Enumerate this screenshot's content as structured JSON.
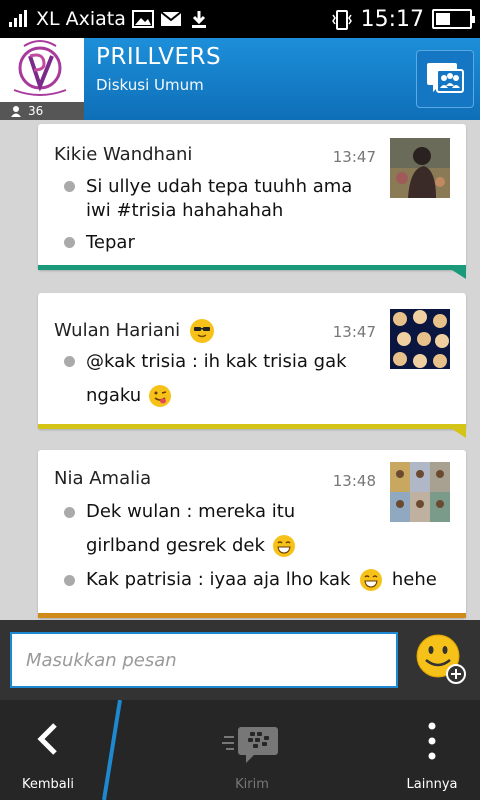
{
  "status_bar": {
    "carrier": "XL Axiata",
    "time": "15:17",
    "battery_level": 0.4
  },
  "header": {
    "group_name": "PRILLVERS",
    "group_subtitle": "Diskusi Umum",
    "member_count": "36",
    "action_icon": "group-chat-icon"
  },
  "messages": [
    {
      "sender": "Kikie Wandhani",
      "time": "13:47",
      "accent_color": "#1a9a7a",
      "lines": [
        "Si ullye udah tepa tuuhh ama",
        "iwi #trisia hahahahah",
        "Tepar"
      ]
    },
    {
      "sender": "Wulan Hariani",
      "time": "13:47",
      "accent_color": "#d4c418",
      "lines": [
        "@kak trisia : ih kak trisia gak",
        "ngaku"
      ]
    },
    {
      "sender": "Nia Amalia",
      "time": "13:48",
      "accent_color": "#d08a1a",
      "lines": [
        "Dek wulan : mereka itu",
        "girlband gesrek dek",
        "Kak patrisia : iyaa aja lho kak",
        "hehe"
      ]
    }
  ],
  "composer": {
    "placeholder": "Masukkan pesan"
  },
  "bottom_bar": {
    "back_label": "Kembali",
    "send_label": "Kirim",
    "more_label": "Lainnya"
  },
  "colors": {
    "header_blue": "#1380cc",
    "input_border": "#1e88d0",
    "emoji_yellow": "#f6c21a"
  }
}
